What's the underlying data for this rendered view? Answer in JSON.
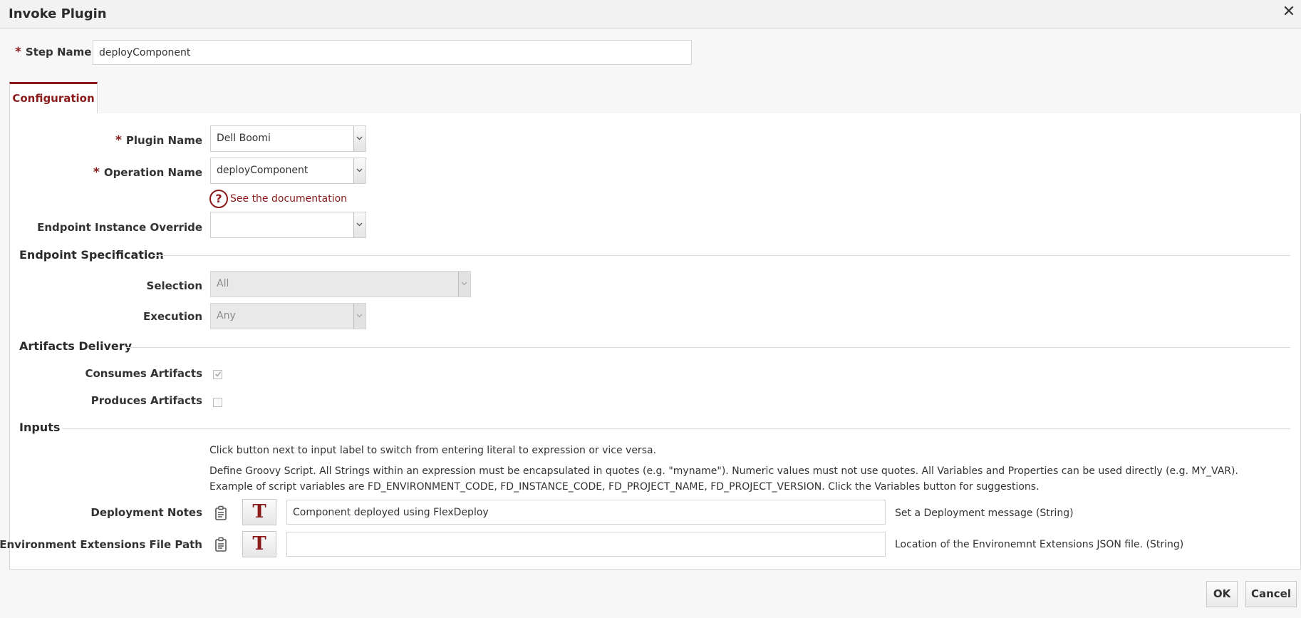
{
  "dialog": {
    "title": "Invoke Plugin",
    "close_label": "✕"
  },
  "step": {
    "label": "Step Name",
    "value": "deployComponent"
  },
  "tabs": [
    {
      "label": "Configuration",
      "active": true
    }
  ],
  "config": {
    "plugin_name": {
      "label": "Plugin Name",
      "value": "Dell Boomi"
    },
    "operation_name": {
      "label": "Operation Name",
      "value": "deployComponent"
    },
    "documentation_link": "See the documentation",
    "endpoint_override": {
      "label": "Endpoint Instance Override",
      "value": ""
    }
  },
  "endpoint_spec": {
    "title": "Endpoint Specification",
    "selection": {
      "label": "Selection",
      "value": "All"
    },
    "execution": {
      "label": "Execution",
      "value": "Any"
    }
  },
  "artifacts": {
    "title": "Artifacts Delivery",
    "consumes": {
      "label": "Consumes Artifacts",
      "checked": true
    },
    "produces": {
      "label": "Produces Artifacts",
      "checked": false
    }
  },
  "inputs": {
    "title": "Inputs",
    "help_1": "Click button next to input label to switch from entering literal to expression or vice versa.",
    "help_2": "Define Groovy Script. All Strings within an expression must be encapsulated in quotes (e.g. \"myname\"). Numeric values must not use quotes. All Variables and Properties can be used directly (e.g. MY_VAR). Example of script variables are FD_ENVIRONMENT_CODE, FD_INSTANCE_CODE, FD_PROJECT_NAME, FD_PROJECT_VERSION. Click the Variables button for suggestions.",
    "fields": [
      {
        "label": "Deployment Notes",
        "value": "Component deployed using FlexDeploy",
        "toggle": "T",
        "description": "Set a Deployment message (String)"
      },
      {
        "label": "Environment Extensions File Path",
        "value": "",
        "toggle": "T",
        "description": "Location of the Environemnt Extensions JSON file. (String)"
      }
    ]
  },
  "footer": {
    "ok_label": "OK",
    "cancel_label": "Cancel"
  },
  "colors": {
    "accent": "#8b1a1a",
    "border": "#d6d6d6",
    "background": "#f7f7f7"
  }
}
